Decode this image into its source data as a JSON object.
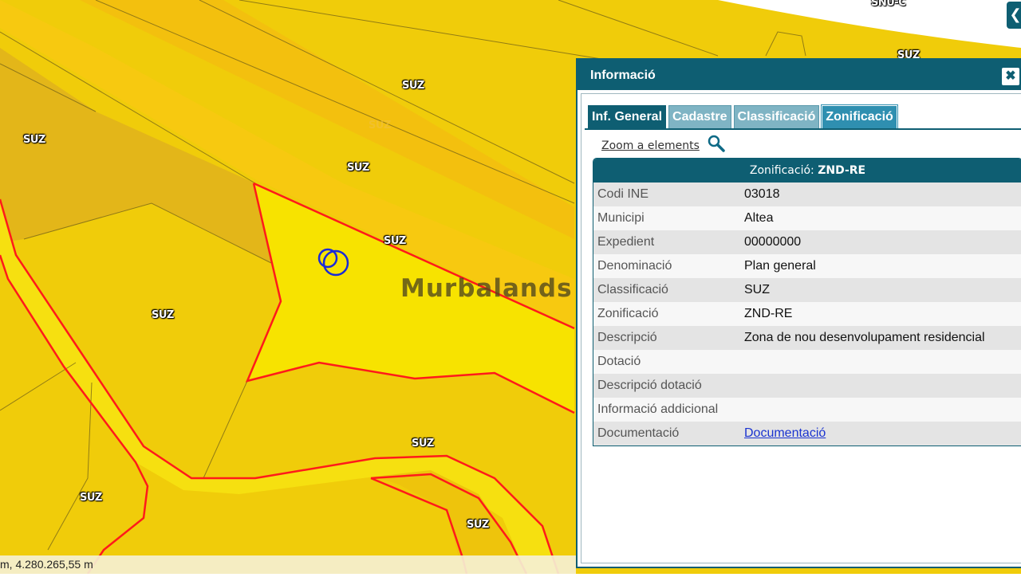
{
  "map": {
    "labels": [
      {
        "text": "SUZ"
      },
      {
        "text": "SUZ"
      },
      {
        "text": "SUZ"
      },
      {
        "text": "SUZ"
      },
      {
        "text": "SUZ"
      },
      {
        "text": "SUZ"
      },
      {
        "text": "SUZ"
      },
      {
        "text": "SUZ"
      },
      {
        "text": "SNU-C"
      },
      {
        "text": "SUZ"
      }
    ],
    "faded_label": "SUZ",
    "colors": {
      "zone_yellow": "#f0cc0a",
      "zone_dark": "#e6b617",
      "zone_bright": "#f7e600",
      "road": "#fac912",
      "highlight_border": "#ff1a1a"
    }
  },
  "watermark": "Murbalands ®",
  "statusbar": {
    "coords": "m, 4.280.265,55 m"
  },
  "top_button": {
    "icon": "chevron-left-icon",
    "glyph": "❮"
  },
  "panel": {
    "title": "Informació",
    "close_glyph": "✖",
    "tabs": [
      {
        "label": "Inf. General"
      },
      {
        "label": "Cadastre"
      },
      {
        "label": "Classificació"
      },
      {
        "label": "Zonificació"
      }
    ],
    "zoom_label": "Zoom a elements",
    "table": {
      "title_prefix": "Zonificació: ",
      "title_value": "ZND-RE",
      "rows": [
        {
          "key": "Codi INE",
          "value": "03018"
        },
        {
          "key": "Municipi",
          "value": "Altea"
        },
        {
          "key": "Expedient",
          "value": "00000000"
        },
        {
          "key": "Denominació",
          "value": "Plan general"
        },
        {
          "key": "Classificació",
          "value": "SUZ"
        },
        {
          "key": "Zonificació",
          "value": "ZND-RE"
        },
        {
          "key": "Descripció",
          "value": "Zona de nou desenvolupament residencial"
        },
        {
          "key": "Dotació",
          "value": ""
        },
        {
          "key": "Descripció dotació",
          "value": ""
        },
        {
          "key": "Informació addicional",
          "value": ""
        },
        {
          "key": "Documentació",
          "value": "Documentació"
        }
      ]
    }
  },
  "accent_color": "#0e5e72"
}
